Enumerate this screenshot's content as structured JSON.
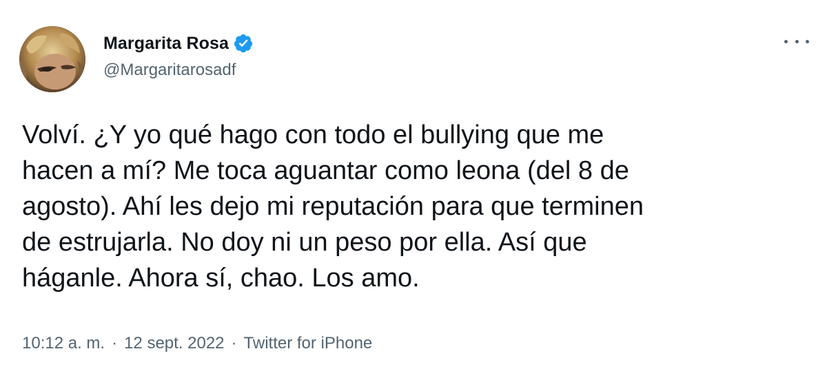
{
  "tweet": {
    "author": {
      "display_name": "Margarita Rosa",
      "handle": "@Margaritarosadf",
      "verified": true,
      "verified_color": "#1d9bf0"
    },
    "text": "Volví. ¿Y yo qué hago con todo el bullying que me\nhacen a mí? Me toca aguantar como leona (del 8 de\nagosto). Ahí les dejo mi reputación para que terminen\nde estrujarla. No doy ni un peso por ella. Así que\nháganle. Ahora sí, chao. Los amo.",
    "meta": {
      "time": "10:12 a. m.",
      "separator": "·",
      "date": "12 sept. 2022",
      "source": "Twitter for iPhone"
    },
    "icons": {
      "more": "more-options-icon",
      "verified": "verified-badge-icon"
    },
    "colors": {
      "text": "#0f1419",
      "secondary": "#536471"
    }
  }
}
